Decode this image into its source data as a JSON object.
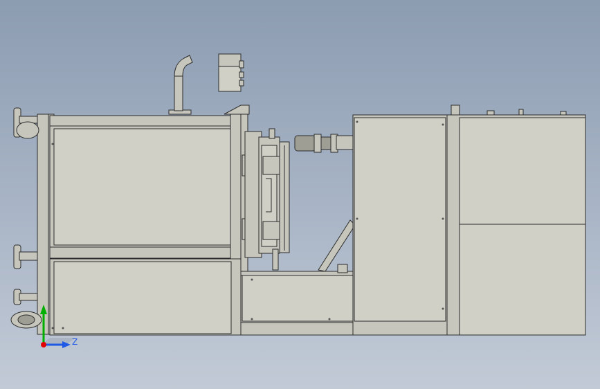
{
  "triad": {
    "z_label": "Z",
    "colors": {
      "x": "#e00000",
      "y": "#00b000",
      "z": "#1e5ae6"
    }
  },
  "colors": {
    "part_fill": "#c6c6bc",
    "edge": "#2b2b2b",
    "background_top": "#8c9cb1",
    "background_bottom": "#c2cad6"
  }
}
